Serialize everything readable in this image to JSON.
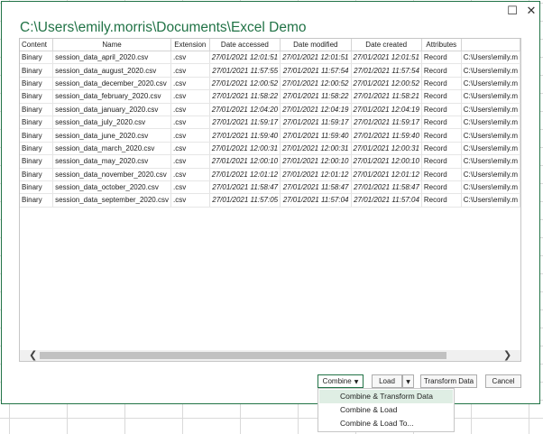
{
  "dialog": {
    "path_title": "C:\\Users\\emily.morris\\Documents\\Excel Demo",
    "window_buttons": {
      "maximize": "☐",
      "close": "✕"
    }
  },
  "table": {
    "columns": [
      "Content",
      "Name",
      "Extension",
      "Date accessed",
      "Date modified",
      "Date created",
      "Attributes",
      ""
    ],
    "rows": [
      [
        "Binary",
        "session_data_april_2020.csv",
        ".csv",
        "27/01/2021 12:01:51",
        "27/01/2021 12:01:51",
        "27/01/2021 12:01:51",
        "Record",
        "C:\\Users\\emily.m"
      ],
      [
        "Binary",
        "session_data_august_2020.csv",
        ".csv",
        "27/01/2021 11:57:55",
        "27/01/2021 11:57:54",
        "27/01/2021 11:57:54",
        "Record",
        "C:\\Users\\emily.m"
      ],
      [
        "Binary",
        "session_data_december_2020.csv",
        ".csv",
        "27/01/2021 12:00:52",
        "27/01/2021 12:00:52",
        "27/01/2021 12:00:52",
        "Record",
        "C:\\Users\\emily.m"
      ],
      [
        "Binary",
        "session_data_february_2020.csv",
        ".csv",
        "27/01/2021 11:58:22",
        "27/01/2021 11:58:22",
        "27/01/2021 11:58:21",
        "Record",
        "C:\\Users\\emily.m"
      ],
      [
        "Binary",
        "session_data_january_2020.csv",
        ".csv",
        "27/01/2021 12:04:20",
        "27/01/2021 12:04:19",
        "27/01/2021 12:04:19",
        "Record",
        "C:\\Users\\emily.m"
      ],
      [
        "Binary",
        "session_data_july_2020.csv",
        ".csv",
        "27/01/2021 11:59:17",
        "27/01/2021 11:59:17",
        "27/01/2021 11:59:17",
        "Record",
        "C:\\Users\\emily.m"
      ],
      [
        "Binary",
        "session_data_june_2020.csv",
        ".csv",
        "27/01/2021 11:59:40",
        "27/01/2021 11:59:40",
        "27/01/2021 11:59:40",
        "Record",
        "C:\\Users\\emily.m"
      ],
      [
        "Binary",
        "session_data_march_2020.csv",
        ".csv",
        "27/01/2021 12:00:31",
        "27/01/2021 12:00:31",
        "27/01/2021 12:00:31",
        "Record",
        "C:\\Users\\emily.m"
      ],
      [
        "Binary",
        "session_data_may_2020.csv",
        ".csv",
        "27/01/2021 12:00:10",
        "27/01/2021 12:00:10",
        "27/01/2021 12:00:10",
        "Record",
        "C:\\Users\\emily.m"
      ],
      [
        "Binary",
        "session_data_november_2020.csv",
        ".csv",
        "27/01/2021 12:01:12",
        "27/01/2021 12:01:12",
        "27/01/2021 12:01:12",
        "Record",
        "C:\\Users\\emily.m"
      ],
      [
        "Binary",
        "session_data_october_2020.csv",
        ".csv",
        "27/01/2021 11:58:47",
        "27/01/2021 11:58:47",
        "27/01/2021 11:58:47",
        "Record",
        "C:\\Users\\emily.m"
      ],
      [
        "Binary",
        "session_data_september_2020.csv",
        ".csv",
        "27/01/2021 11:57:05",
        "27/01/2021 11:57:04",
        "27/01/2021 11:57:04",
        "Record",
        "C:\\Users\\emily.m"
      ]
    ]
  },
  "scrollbar": {
    "left_arrow": "❮",
    "right_arrow": "❯"
  },
  "buttons": {
    "combine": "Combine",
    "load": "Load",
    "transform": "Transform Data",
    "cancel": "Cancel",
    "caret": "▼"
  },
  "combine_menu": {
    "items": [
      "Combine & Transform Data",
      "Combine & Load",
      "Combine & Load To..."
    ]
  },
  "colors": {
    "accent": "#217346",
    "menu_hover": "#dfeee4"
  }
}
